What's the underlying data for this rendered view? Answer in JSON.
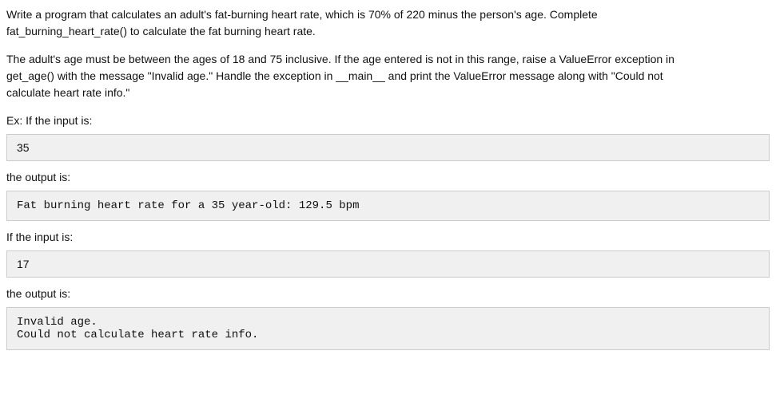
{
  "description": {
    "line1": "Write a program that calculates an adult's fat-burning heart rate, which is 70% of 220 minus the person's age. Complete",
    "line2": "fat_burning_heart_rate() to calculate the fat burning heart rate.",
    "line3": "The adult's age must be between the ages of 18 and 75 inclusive. If the age entered is not in this range, raise a ValueError exception in",
    "line4": "get_age() with the message \"Invalid age.\" Handle the exception in __main__ and print the ValueError message along with \"Could not",
    "line5": "calculate heart rate info.\""
  },
  "example1": {
    "intro_label": "Ex: If the input is:",
    "input_value": "35",
    "output_label": "the output is:",
    "output_value": "Fat burning heart rate for a 35 year-old: 129.5 bpm"
  },
  "example2": {
    "intro_label": "If the input is:",
    "input_value": "17",
    "output_label": "the output is:",
    "output_value": "Invalid age.\nCould not calculate heart rate info."
  }
}
